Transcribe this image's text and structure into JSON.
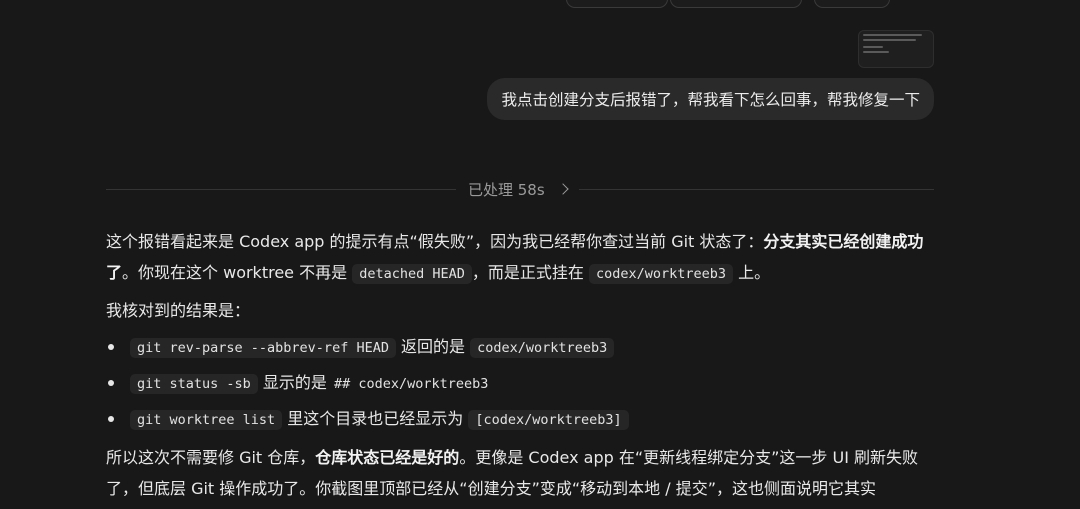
{
  "chat": {
    "user_message": "我点击创建分支后报错了，帮我看下怎么回事，帮我修复一下",
    "processed_label": "已处理 58s",
    "assistant": {
      "p1_a": "这个报错看起来是 Codex app 的提示有点“假失败”，因为我已经帮你查过当前 Git 状态了：",
      "p1_bold": "分支其实已经创建成功了",
      "p1_b": "。你现在这个 worktree 不再是 ",
      "p1_code1": "detached HEAD",
      "p1_c": "，而是正式挂在 ",
      "p1_code2": "codex/worktreeb3",
      "p1_d": " 上。",
      "p2": "我核对到的结果是：",
      "bullets": [
        {
          "code": "git rev-parse --abbrev-ref HEAD",
          "text": " 返回的是 ",
          "code2": "codex/worktreeb3"
        },
        {
          "code": "git status -sb",
          "text": " 显示的是 ",
          "code2": "## codex/worktreeb3"
        },
        {
          "code": "git worktree list",
          "text": " 里这个目录也已经显示为 ",
          "code2": "[codex/worktreeb3]"
        }
      ],
      "p3_a": "所以这次不需要修 Git 仓库，",
      "p3_bold": "仓库状态已经是好的",
      "p3_b": "。更像是 Codex app 在“更新线程绑定分支”这一步 UI 刷新失败了，但底层 Git 操作成功了。你截图里顶部已经从“创建分支”变成“移动到本地 / 提交”，这也侧面说明它其实"
    }
  }
}
